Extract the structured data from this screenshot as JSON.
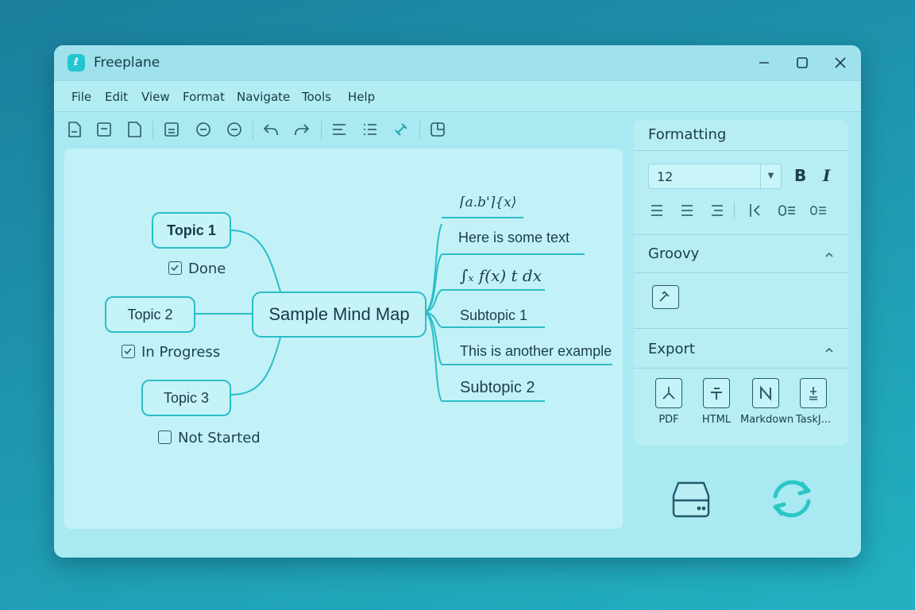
{
  "window": {
    "title": "Freeplane"
  },
  "menu": [
    "File",
    "Edit",
    "View",
    "Format",
    "Navigate",
    "Tools",
    "Help"
  ],
  "toolbar": {
    "icons": [
      "new-file-icon",
      "open-file-icon",
      "save-file-icon",
      "insert-node-icon",
      "collapse-icon",
      "fold-icon",
      "undo-icon",
      "redo-icon",
      "align-icon",
      "list-icon",
      "link-icon",
      "export-page-icon"
    ]
  },
  "mindmap": {
    "central": "Sample Mind Map",
    "left_topics": [
      {
        "label": "Topic 1",
        "status": "Done",
        "checked": true
      },
      {
        "label": "Topic 2",
        "status": "In Progress",
        "checked": true
      },
      {
        "label": "Topic 3",
        "status": "Not Started",
        "checked": false
      }
    ],
    "right_children": [
      "⌈a.b'⌉{x⟩",
      "Here is some text",
      "∫ₓ f(x) t dx",
      "Subtopic 1",
      "This is another example",
      "Subtopic 2"
    ]
  },
  "panel": {
    "formatting_title": "Formatting",
    "font_size": "12",
    "bold_label": "B",
    "italic_label": "I",
    "groovy_title": "Groovy",
    "export_title": "Export",
    "export_items": [
      "PDF",
      "HTML",
      "Markdown",
      "TaskJ..."
    ]
  },
  "colors": {
    "accent": "#2bbdc8",
    "window_bg": "#a9e9f1",
    "canvas_bg": "#c2f2f7"
  }
}
